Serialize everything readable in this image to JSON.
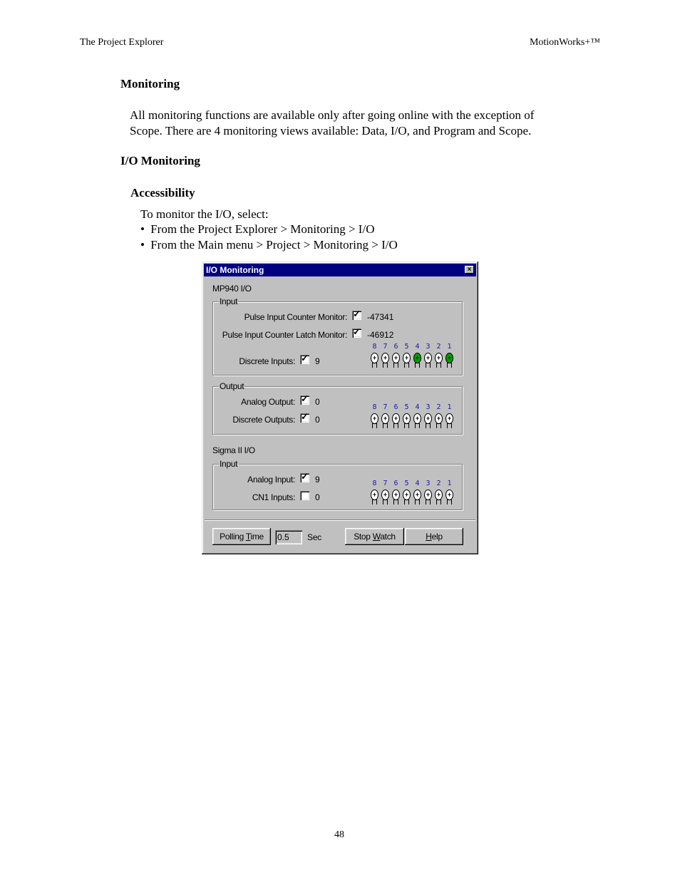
{
  "page": {
    "header_left": "The Project Explorer",
    "header_right": "MotionWorks+™",
    "heading_monitoring": "Monitoring",
    "intro_line1": "All monitoring functions are available only after going online with the exception of",
    "intro_line2": "Scope. There are 4 monitoring views available:  Data, I/O, and Program and Scope.",
    "heading_io": "I/O Monitoring",
    "heading_access": "Accessibility",
    "access_intro": "To monitor the I/O, select:",
    "bullets": [
      "From the Project Explorer > Monitoring > I/O",
      "From the Main menu > Project > Monitoring > I/O"
    ],
    "bullet_glyph": "•",
    "page_number": "48"
  },
  "dialog": {
    "title": "I/O Monitoring",
    "close_glyph": "×",
    "mp940_label": "MP940 I/O",
    "mp940_input": {
      "legend": "Input",
      "pulse_counter": {
        "label": "Pulse Input Counter Monitor:",
        "checked": true,
        "value": "-47341"
      },
      "pulse_latch": {
        "label": "Pulse Input Counter Latch Monitor:",
        "checked": true,
        "value": "-46912"
      },
      "discrete": {
        "label": "Discrete Inputs:",
        "checked": true,
        "value": "9"
      },
      "leds": [
        {
          "num": "8",
          "on": false
        },
        {
          "num": "7",
          "on": false
        },
        {
          "num": "6",
          "on": false
        },
        {
          "num": "5",
          "on": false
        },
        {
          "num": "4",
          "on": true
        },
        {
          "num": "3",
          "on": false
        },
        {
          "num": "2",
          "on": false
        },
        {
          "num": "1",
          "on": true
        }
      ]
    },
    "mp940_output": {
      "legend": "Output",
      "analog": {
        "label": "Analog Output:",
        "checked": true,
        "value": "0"
      },
      "discrete": {
        "label": "Discrete Outputs:",
        "checked": true,
        "value": "0"
      },
      "leds": [
        {
          "num": "8",
          "on": false
        },
        {
          "num": "7",
          "on": false
        },
        {
          "num": "6",
          "on": false
        },
        {
          "num": "5",
          "on": false
        },
        {
          "num": "4",
          "on": false
        },
        {
          "num": "3",
          "on": false
        },
        {
          "num": "2",
          "on": false
        },
        {
          "num": "1",
          "on": false
        }
      ]
    },
    "sigma_label": "Sigma II I/O",
    "sigma_input": {
      "legend": "Input",
      "analog": {
        "label": "Analog Input:",
        "checked": true,
        "value": "9"
      },
      "cn1": {
        "label": "CN1 Inputs:",
        "checked": false,
        "value": "0"
      },
      "leds": [
        {
          "num": "8",
          "on": false
        },
        {
          "num": "7",
          "on": false
        },
        {
          "num": "6",
          "on": false
        },
        {
          "num": "5",
          "on": false
        },
        {
          "num": "4",
          "on": false
        },
        {
          "num": "3",
          "on": false
        },
        {
          "num": "2",
          "on": false
        },
        {
          "num": "1",
          "on": false
        }
      ]
    },
    "buttons": {
      "polling_pre": "Polling ",
      "polling_key": "T",
      "polling_post": "ime",
      "polling_value": "0.5",
      "polling_unit": "Sec",
      "stopwatch_pre": "Stop ",
      "stopwatch_key": "W",
      "stopwatch_post": "atch",
      "help_key": "H",
      "help_post": "elp"
    },
    "colors": {
      "titlebar": "#000080",
      "led_on": "#00a000",
      "led_number": "#1a1aa6",
      "face": "#c0c0c0"
    }
  }
}
